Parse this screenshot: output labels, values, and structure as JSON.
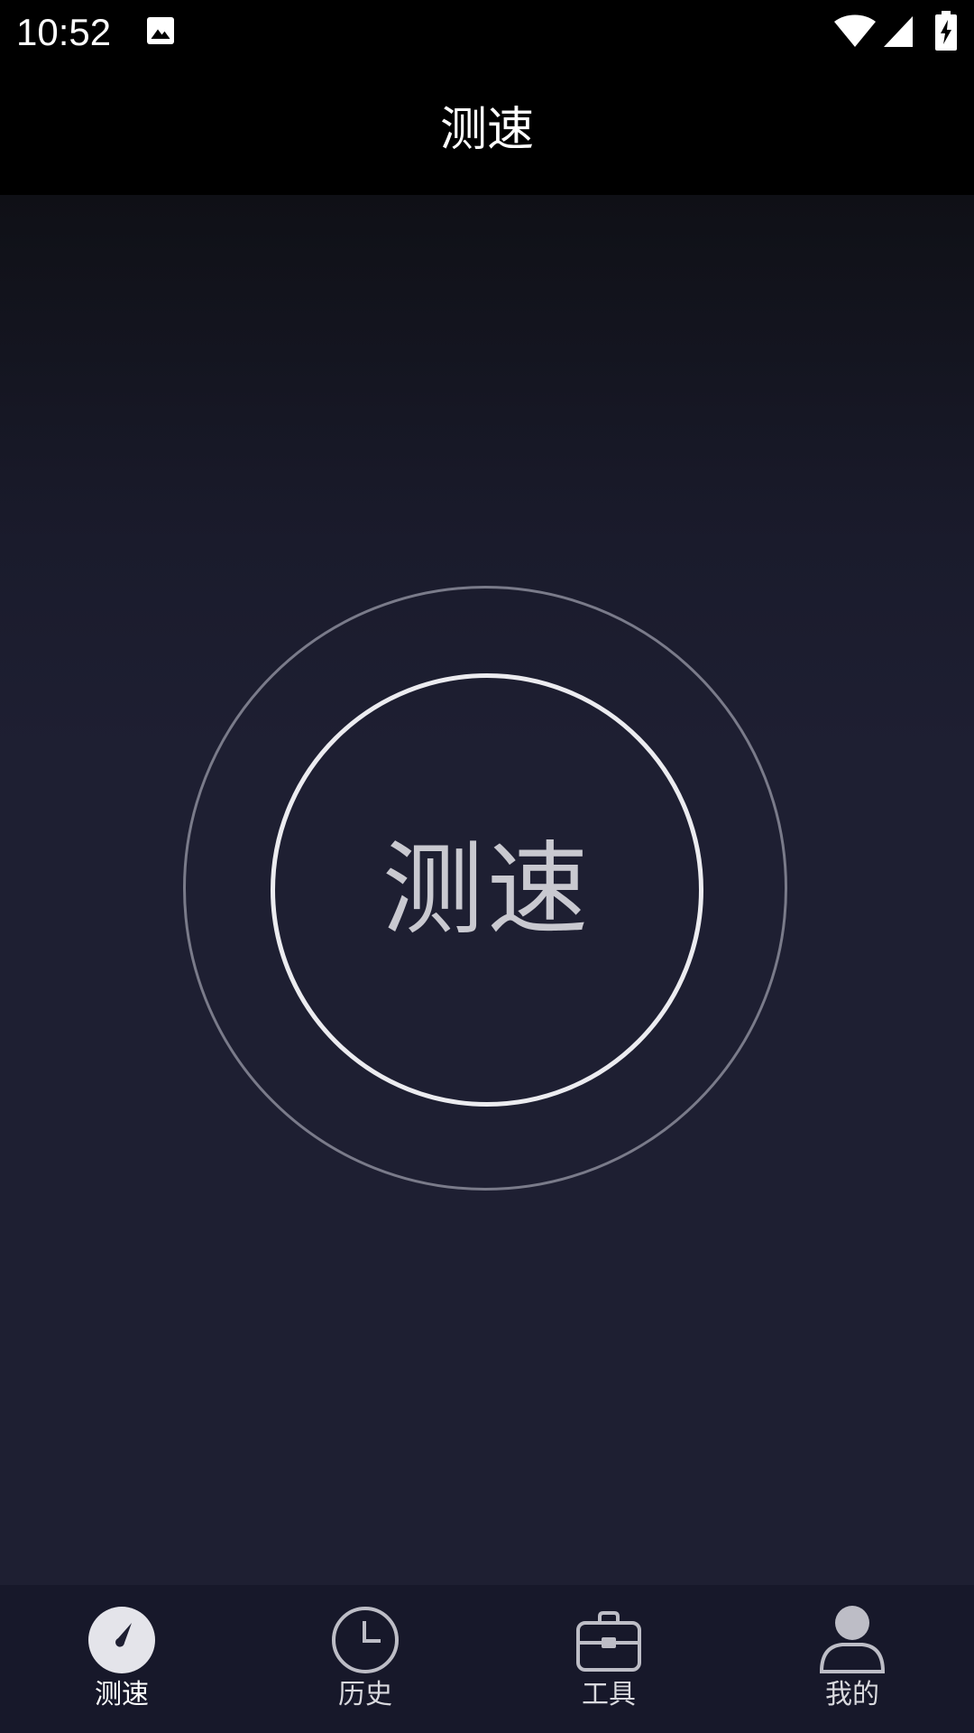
{
  "status_bar": {
    "time": "10:52",
    "icons": [
      "gallery-icon",
      "wifi-icon",
      "signal-icon",
      "battery-charging-icon"
    ]
  },
  "header": {
    "title": "测速"
  },
  "main": {
    "start_button_label": "测速"
  },
  "bottom_nav": {
    "items": [
      {
        "label": "测速",
        "icon": "speedometer-icon",
        "active": true
      },
      {
        "label": "历史",
        "icon": "clock-icon",
        "active": false
      },
      {
        "label": "工具",
        "icon": "toolbox-icon",
        "active": false
      },
      {
        "label": "我的",
        "icon": "user-icon",
        "active": false
      }
    ]
  },
  "colors": {
    "background": "#1e1f32",
    "nav_background": "#17182a",
    "ring_outer": "#7a7b8a",
    "ring_inner": "#ececf0",
    "text_muted": "#c9c9d0"
  }
}
